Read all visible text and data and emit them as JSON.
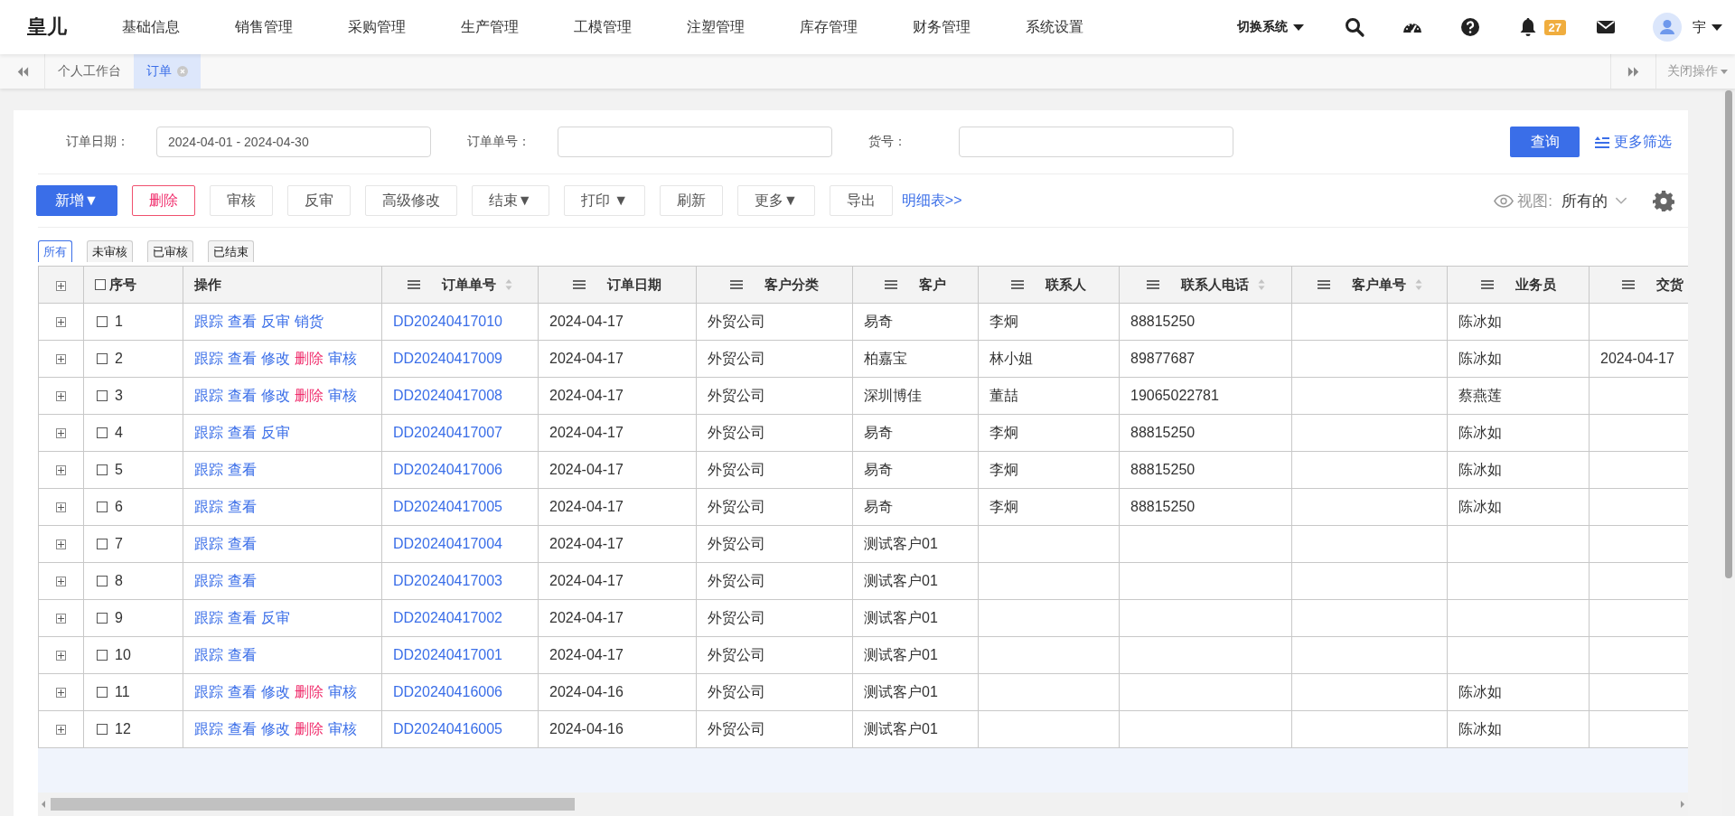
{
  "logo": "皇儿",
  "nav": [
    {
      "label": "基础信息"
    },
    {
      "label": "销售管理"
    },
    {
      "label": "采购管理"
    },
    {
      "label": "生产管理"
    },
    {
      "label": "工模管理"
    },
    {
      "label": "注塑管理"
    },
    {
      "label": "库存管理"
    },
    {
      "label": "财务管理"
    },
    {
      "label": "系统设置"
    }
  ],
  "system_switch": "切换系统",
  "notification_count": "27",
  "user": "宇",
  "page_tabs": [
    {
      "label": "个人工作台",
      "selected": false,
      "closable": false
    },
    {
      "label": "订单",
      "selected": true,
      "closable": true
    }
  ],
  "close_menu": "关闭操作",
  "filters": [
    {
      "label": "订单日期：",
      "value": "2024-04-01 - 2024-04-30"
    },
    {
      "label": "订单单号："
    },
    {
      "label": "货号："
    }
  ],
  "query_button": "查询",
  "more_filters": "更多筛选",
  "toolbar": [
    {
      "label": "新增▼",
      "kind": "primary"
    },
    {
      "label": "删除",
      "kind": "danger"
    },
    {
      "label": "审核",
      "kind": "default"
    },
    {
      "label": "反审",
      "kind": "default"
    },
    {
      "label": "高级修改",
      "kind": "default"
    },
    {
      "label": "结束▼",
      "kind": "default"
    },
    {
      "label": "打印 ▼",
      "kind": "default"
    },
    {
      "label": "刷新",
      "kind": "default"
    },
    {
      "label": "更多▼",
      "kind": "default"
    },
    {
      "label": "导出",
      "kind": "default"
    },
    {
      "label": "明细表>>",
      "kind": "link"
    }
  ],
  "view": {
    "label": "视图:",
    "value": "所有的"
  },
  "status_tabs": [
    {
      "label": "所有",
      "selected": true
    },
    {
      "label": "未审核",
      "selected": false
    },
    {
      "label": "已审核",
      "selected": false
    },
    {
      "label": "已结束",
      "selected": false
    }
  ],
  "columns": [
    {
      "label": "序号",
      "menu": false,
      "sortable": false
    },
    {
      "label": "操作",
      "menu": false,
      "sortable": false
    },
    {
      "label": "订单单号",
      "menu": true,
      "sortable": true
    },
    {
      "label": "订单日期",
      "menu": true,
      "sortable": false
    },
    {
      "label": "客户分类",
      "menu": true,
      "sortable": false
    },
    {
      "label": "客户",
      "menu": true,
      "sortable": false
    },
    {
      "label": "联系人",
      "menu": true,
      "sortable": false
    },
    {
      "label": "联系人电话",
      "menu": true,
      "sortable": true
    },
    {
      "label": "客户单号",
      "menu": true,
      "sortable": true
    },
    {
      "label": "业务员",
      "menu": true,
      "sortable": false
    },
    {
      "label": "交货",
      "menu": true,
      "sortable": false
    }
  ],
  "rows": [
    {
      "seq": "1",
      "checked": false,
      "ops": [
        {
          "label": "跟踪",
          "kind": "normal"
        },
        {
          "label": "查看",
          "kind": "normal"
        },
        {
          "label": "反审",
          "kind": "normal"
        },
        {
          "label": "销货",
          "kind": "normal"
        }
      ],
      "order_no": "DD20240417010",
      "date": "2024-04-17",
      "customer_class": "外贸公司",
      "customer": "易奇",
      "contact": "李炯",
      "phone": "88815250",
      "salesman": "陈冰如"
    },
    {
      "seq": "2",
      "checked": false,
      "ops": [
        {
          "label": "跟踪",
          "kind": "normal"
        },
        {
          "label": "查看",
          "kind": "normal"
        },
        {
          "label": "修改",
          "kind": "normal"
        },
        {
          "label": "删除",
          "kind": "danger"
        },
        {
          "label": "审核",
          "kind": "normal"
        }
      ],
      "order_no": "DD20240417009",
      "date": "2024-04-17",
      "customer_class": "外贸公司",
      "customer": "柏嘉宝",
      "contact": "林小姐",
      "phone": "89877687",
      "salesman": "陈冰如",
      "delivery": "2024-04-17"
    },
    {
      "seq": "3",
      "checked": false,
      "ops": [
        {
          "label": "跟踪",
          "kind": "normal"
        },
        {
          "label": "查看",
          "kind": "normal"
        },
        {
          "label": "修改",
          "kind": "normal"
        },
        {
          "label": "删除",
          "kind": "danger"
        },
        {
          "label": "审核",
          "kind": "normal"
        }
      ],
      "order_no": "DD20240417008",
      "date": "2024-04-17",
      "customer_class": "外贸公司",
      "customer": "深圳博佳",
      "contact": "董喆",
      "phone": "19065022781",
      "salesman": "蔡燕莲"
    },
    {
      "seq": "4",
      "checked": false,
      "ops": [
        {
          "label": "跟踪",
          "kind": "normal"
        },
        {
          "label": "查看",
          "kind": "normal"
        },
        {
          "label": "反审",
          "kind": "normal"
        }
      ],
      "order_no": "DD20240417007",
      "date": "2024-04-17",
      "customer_class": "外贸公司",
      "customer": "易奇",
      "contact": "李炯",
      "phone": "88815250",
      "salesman": "陈冰如"
    },
    {
      "seq": "5",
      "checked": false,
      "ops": [
        {
          "label": "跟踪",
          "kind": "normal"
        },
        {
          "label": "查看",
          "kind": "normal"
        }
      ],
      "order_no": "DD20240417006",
      "date": "2024-04-17",
      "customer_class": "外贸公司",
      "customer": "易奇",
      "contact": "李炯",
      "phone": "88815250",
      "salesman": "陈冰如"
    },
    {
      "seq": "6",
      "checked": false,
      "ops": [
        {
          "label": "跟踪",
          "kind": "normal"
        },
        {
          "label": "查看",
          "kind": "normal"
        }
      ],
      "order_no": "DD20240417005",
      "date": "2024-04-17",
      "customer_class": "外贸公司",
      "customer": "易奇",
      "contact": "李炯",
      "phone": "88815250",
      "salesman": "陈冰如"
    },
    {
      "seq": "7",
      "checked": false,
      "ops": [
        {
          "label": "跟踪",
          "kind": "normal"
        },
        {
          "label": "查看",
          "kind": "normal"
        }
      ],
      "order_no": "DD20240417004",
      "date": "2024-04-17",
      "customer_class": "外贸公司",
      "customer": "测试客户01"
    },
    {
      "seq": "8",
      "checked": false,
      "ops": [
        {
          "label": "跟踪",
          "kind": "normal"
        },
        {
          "label": "查看",
          "kind": "normal"
        }
      ],
      "order_no": "DD20240417003",
      "date": "2024-04-17",
      "customer_class": "外贸公司",
      "customer": "测试客户01"
    },
    {
      "seq": "9",
      "checked": false,
      "ops": [
        {
          "label": "跟踪",
          "kind": "normal"
        },
        {
          "label": "查看",
          "kind": "normal"
        },
        {
          "label": "反审",
          "kind": "normal"
        }
      ],
      "order_no": "DD20240417002",
      "date": "2024-04-17",
      "customer_class": "外贸公司",
      "customer": "测试客户01"
    },
    {
      "seq": "10",
      "checked": false,
      "ops": [
        {
          "label": "跟踪",
          "kind": "normal"
        },
        {
          "label": "查看",
          "kind": "normal"
        }
      ],
      "order_no": "DD20240417001",
      "date": "2024-04-17",
      "customer_class": "外贸公司",
      "customer": "测试客户01"
    },
    {
      "seq": "11",
      "checked": false,
      "ops": [
        {
          "label": "跟踪",
          "kind": "normal"
        },
        {
          "label": "查看",
          "kind": "normal"
        },
        {
          "label": "修改",
          "kind": "normal"
        },
        {
          "label": "删除",
          "kind": "danger"
        },
        {
          "label": "审核",
          "kind": "normal"
        }
      ],
      "order_no": "DD20240416006",
      "date": "2024-04-16",
      "customer_class": "外贸公司",
      "customer": "测试客户01",
      "salesman": "陈冰如"
    },
    {
      "seq": "12",
      "checked": false,
      "ops": [
        {
          "label": "跟踪",
          "kind": "normal"
        },
        {
          "label": "查看",
          "kind": "normal"
        },
        {
          "label": "修改",
          "kind": "normal"
        },
        {
          "label": "删除",
          "kind": "danger"
        },
        {
          "label": "审核",
          "kind": "normal"
        }
      ],
      "order_no": "DD20240416005",
      "date": "2024-04-16",
      "customer_class": "外贸公司",
      "customer": "测试客户01",
      "salesman": "陈冰如"
    }
  ]
}
